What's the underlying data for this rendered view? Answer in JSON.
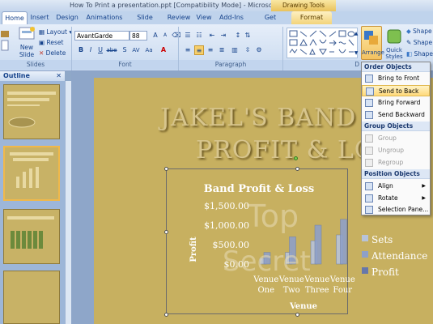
{
  "window": {
    "title": "How To Print a presentation.ppt [Compatibility Mode] - Microsoft PowerPoint",
    "context_tab": "Drawing Tools"
  },
  "tabs": [
    "Home",
    "Insert",
    "Design",
    "Animations",
    "Slide Show",
    "Review",
    "View",
    "Add-Ins",
    "Get Started",
    "Format"
  ],
  "ribbon": {
    "slides_group": {
      "label": "Slides",
      "new_slide": "New Slide",
      "layout": "Layout",
      "reset": "Reset",
      "delete": "Delete"
    },
    "font_group": {
      "label": "Font",
      "font_name": "AvantGarde",
      "font_size": "88",
      "bold": "B",
      "italic": "I",
      "underline": "U",
      "strike": "abe",
      "shadow": "S"
    },
    "paragraph_group": {
      "label": "Paragraph"
    },
    "drawing_group": {
      "label": "D",
      "arrange": "Arrange",
      "quick_styles": "Quick Styles",
      "shape_fill": "Shape F",
      "shape_outline": "Shape O",
      "shape_effects": "Shape E"
    }
  },
  "outline_tab": "Outline",
  "slide": {
    "title_line1": "JAKEL'S BAND",
    "title_line2": "PROFIT & LO",
    "watermark_top": "Top",
    "watermark_bottom": "Secret"
  },
  "chart_data": {
    "type": "bar",
    "title": "Band Profit & Loss",
    "xlabel": "Venue",
    "ylabel": "Profit",
    "categories": [
      "Venue One",
      "Venue Two",
      "Venue Three",
      "Venue Four"
    ],
    "category_lines": [
      [
        "Venue",
        "One"
      ],
      [
        "Venue",
        "Two"
      ],
      [
        "Venue",
        "Three"
      ],
      [
        "Venue",
        "Four"
      ]
    ],
    "yticks": [
      "$1,500.00",
      "$1,000.00",
      "$500.00",
      "$0.00"
    ],
    "ylim": [
      0,
      1500
    ],
    "series": [
      {
        "name": "Sets",
        "values": [
          150,
          300,
          600,
          750
        ],
        "color": "#b7c3d9"
      },
      {
        "name": "Attendance",
        "values": [
          300,
          700,
          1000,
          1150
        ],
        "color": "#8ea0c8"
      },
      {
        "name": "Profit",
        "values": [
          0,
          0,
          0,
          0
        ],
        "color": "#6677aa"
      }
    ],
    "legend": "right"
  },
  "menu": {
    "order_header": "Order Objects",
    "bring_to_front": "Bring to Front",
    "send_to_back": "Send to Back",
    "bring_forward": "Bring Forward",
    "send_backward": "Send Backward",
    "group_header": "Group Objects",
    "group": "Group",
    "ungroup": "Ungroup",
    "regroup": "Regroup",
    "position_header": "Position Objects",
    "align": "Align",
    "rotate": "Rotate",
    "selection_pane": "Selection Pane..."
  }
}
